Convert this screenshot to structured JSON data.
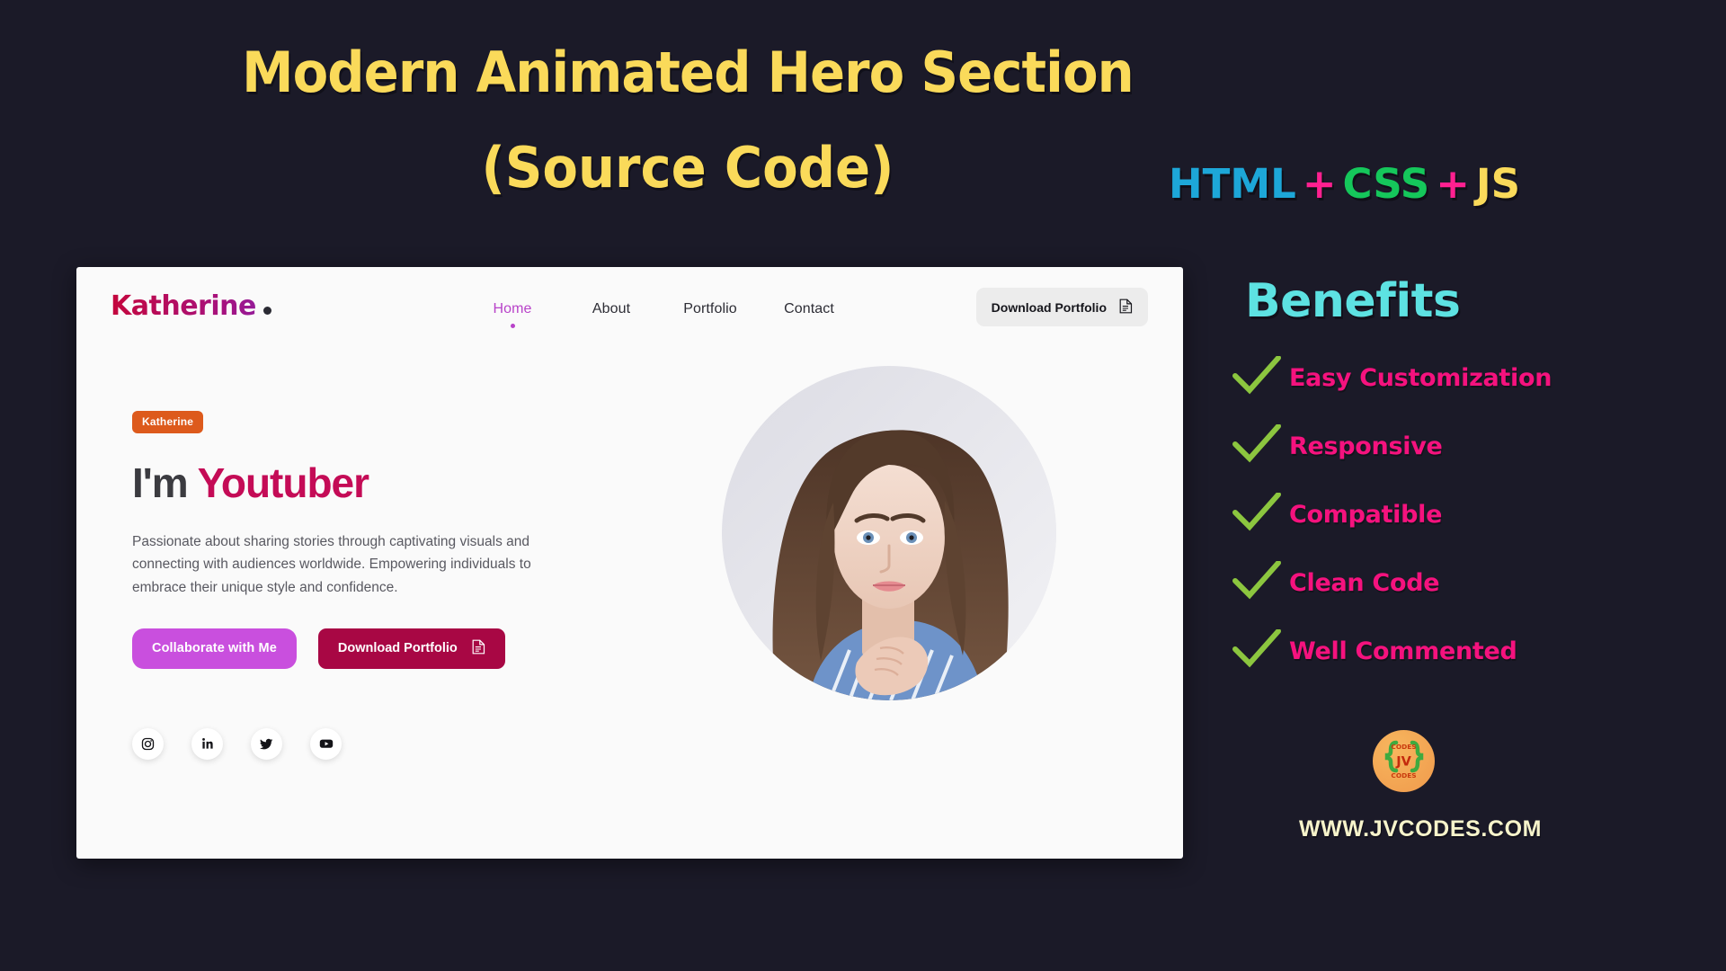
{
  "banner": {
    "title_line1": "Modern Animated Hero Section",
    "title_line2": "(Source Code)",
    "stack": {
      "html": "HTML",
      "plus1": "+",
      "css": "CSS",
      "plus2": "+",
      "js": "JS"
    },
    "colors": {
      "title": "#fada5a",
      "html": "#1da7d8",
      "plus": "#ff2090",
      "css": "#15c75b",
      "js": "#fada5a",
      "background": "#1b1a28"
    }
  },
  "site": {
    "brand": "Katherine",
    "nav": [
      {
        "label": "Home",
        "active": true
      },
      {
        "label": "About",
        "active": false
      },
      {
        "label": "Portfolio",
        "active": false
      },
      {
        "label": "Contact",
        "active": false
      }
    ],
    "nav_cta": "Download Portfolio",
    "hero": {
      "badge": "Katherine",
      "title_prefix": "I'm ",
      "title_accent": "Youtuber",
      "description": "Passionate about sharing stories through captivating visuals and connecting with audiences worldwide. Empowering individuals to embrace their unique style and confidence.",
      "btn_primary": "Collaborate with Me",
      "btn_secondary": "Download Portfolio",
      "socials": [
        "instagram",
        "linkedin",
        "twitter",
        "youtube"
      ]
    },
    "colors": {
      "card_bg": "#fafafa",
      "accent": "#c40b56",
      "nav_active": "#b843c9",
      "badge_bg": "#dd5a1c",
      "btn_primary_bg": "#c94fde",
      "btn_secondary_bg": "#a80744"
    }
  },
  "benefits": {
    "heading": "Benefits",
    "heading_color": "#5de2e2",
    "item_color": "#f5127e",
    "check_color": "#8cc63f",
    "items": [
      "Easy Customization",
      "Responsive",
      "Compatible",
      "Clean Code",
      "Well Commented"
    ]
  },
  "footer": {
    "logo_text_top": "CODES",
    "logo_text_mid": "JV",
    "logo_text_bottom": "CODES",
    "url": "WWW.JVCODES.COM",
    "url_color": "#f7f4cb"
  }
}
